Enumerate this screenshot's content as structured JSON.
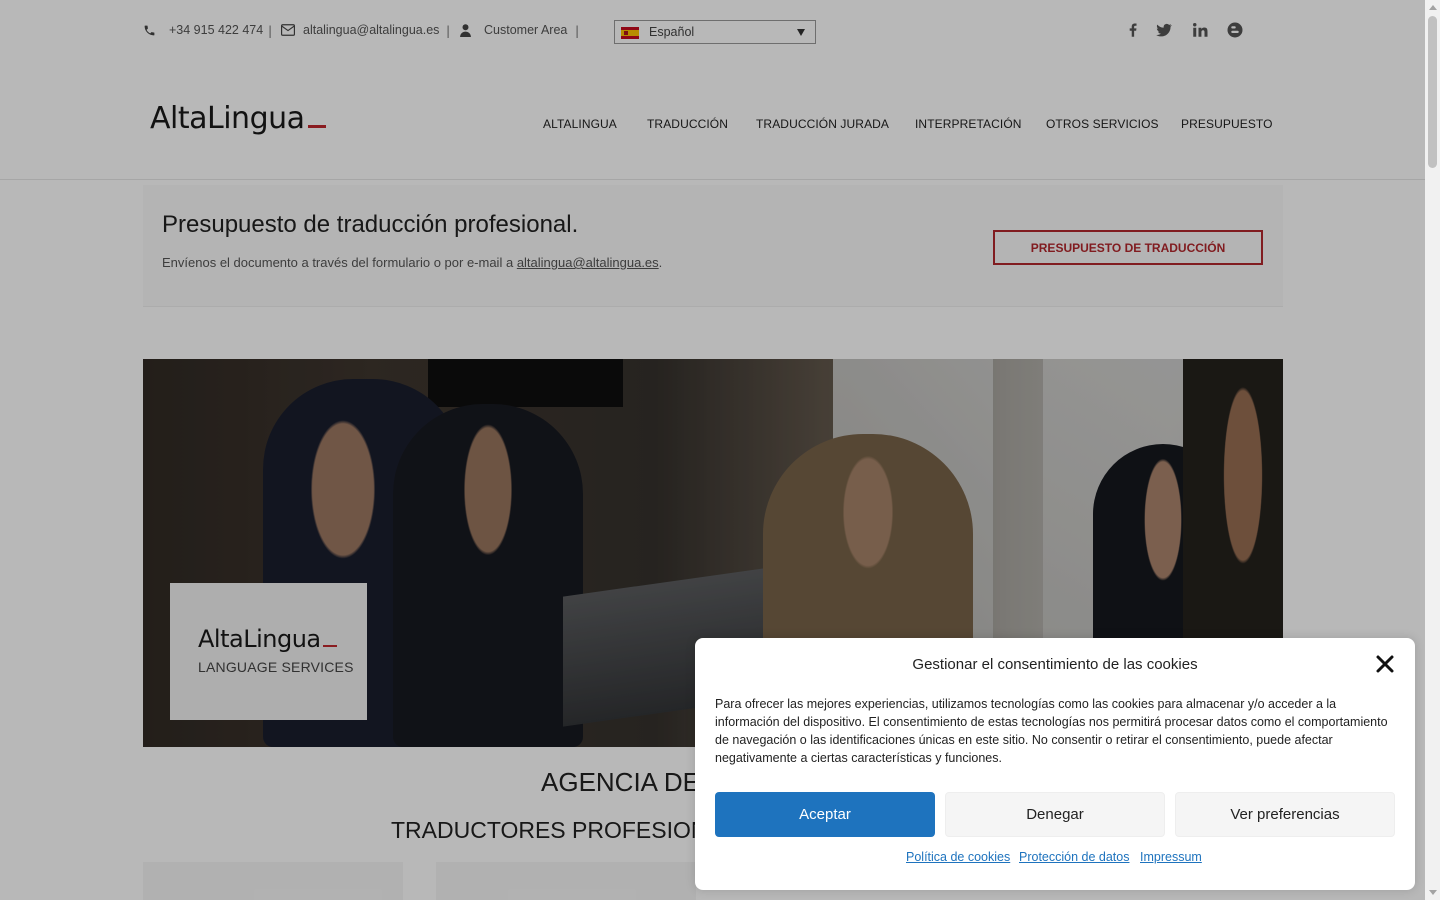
{
  "topbar": {
    "phone": "+34 915 422 474",
    "email": "altalingua@altalingua.es",
    "customer_area": "Customer Area",
    "separator": "|",
    "language": "Español",
    "social_icons": [
      "facebook-icon",
      "twitter-icon",
      "linkedin-icon",
      "blogger-icon"
    ]
  },
  "header": {
    "logo_text": "AltaLingua",
    "nav": [
      "ALTALINGUA",
      "TRADUCCIÓN",
      "TRADUCCIÓN JURADA",
      "INTERPRETACIÓN",
      "OTROS SERVICIOS",
      "PRESUPUESTO"
    ]
  },
  "quote": {
    "title": "Presupuesto de traducción profesional.",
    "text": "Envíenos el documento a través del formulario o por e-mail a",
    "email": "altalingua@altalingua.es",
    "period": ".",
    "button": "PRESUPUESTO DE TRADUCCIÓN"
  },
  "hero": {
    "logo_title": "AltaLingua",
    "logo_subtitle": "LANGUAGE SERVICES"
  },
  "main": {
    "heading1": "AGENCIA DE",
    "heading2": "TRADUCTORES PROFESION"
  },
  "cookie_modal": {
    "title": "Gestionar el consentimiento de las cookies",
    "body": "Para ofrecer las mejores experiencias, utilizamos tecnologías como las cookies para almacenar y/o acceder a la información del dispositivo. El consentimiento de estas tecnologías nos permitirá procesar datos como el comportamiento de navegación o las identificaciones únicas en este sitio. No consentir o retirar el consentimiento, puede afectar negativamente a ciertas características y funciones.",
    "accept": "Aceptar",
    "deny": "Denegar",
    "preferences": "Ver preferencias",
    "links": [
      "Política de cookies",
      "Protección de datos",
      "Impressum"
    ]
  },
  "colors": {
    "accent_red": "#b3282d",
    "primary_blue": "#1e73be"
  }
}
